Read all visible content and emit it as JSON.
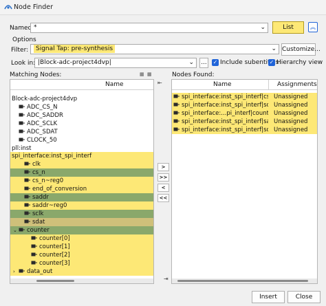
{
  "window": {
    "title": "Node Finder"
  },
  "named": {
    "label": "Named:",
    "value": "*"
  },
  "list_button": "List",
  "options": {
    "heading": "Options",
    "filter_label": "Filter:",
    "filter_value": "Signal Tap: pre-synthesis",
    "customize_label": "Customize...",
    "lookin_label": "Look in:",
    "lookin_value": "|Block-adc-project4dvp|",
    "browse_label": "...",
    "include_subentities": "Include subentities",
    "hierarchy_view": "Hierarchy view"
  },
  "matching": {
    "label": "Matching Nodes:",
    "header": "Name",
    "rows": [
      {
        "text": "Block-adc-project4dvp"
      },
      {
        "text": "ADC_CS_N"
      },
      {
        "text": "ADC_SADDR"
      },
      {
        "text": "ADC_SCLK"
      },
      {
        "text": "ADC_SDAT"
      },
      {
        "text": "CLOCK_50"
      },
      {
        "text": "pll:inst",
        "arrow": ">"
      },
      {
        "text": "spi_interface:inst_spi_interf",
        "arrow": "v"
      },
      {
        "text": "clk"
      },
      {
        "text": "cs_n"
      },
      {
        "text": "cs_n~reg0"
      },
      {
        "text": "end_of_conversion"
      },
      {
        "text": "saddr"
      },
      {
        "text": "saddr~reg0"
      },
      {
        "text": "sclk"
      },
      {
        "text": "sdat"
      },
      {
        "text": "counter",
        "arrow": "v"
      },
      {
        "text": "counter[0]"
      },
      {
        "text": "counter[1]"
      },
      {
        "text": "counter[2]"
      },
      {
        "text": "counter[3]"
      },
      {
        "text": "data_out",
        "arrow": ">"
      }
    ]
  },
  "transfer": {
    "add": ">",
    "add_all": ">>",
    "remove": "<",
    "remove_all": "<<"
  },
  "found": {
    "label": "Nodes Found:",
    "headers": [
      "Name",
      "Assignments"
    ],
    "rows": [
      {
        "name": "spi_interface:inst_spi_interf|cs_n",
        "assign": "Unassigned"
      },
      {
        "name": "spi_interface:inst_spi_interf|sclk",
        "assign": "Unassigned"
      },
      {
        "name": "spi_interface:...pi_interf|counter",
        "assign": "Unassigned"
      },
      {
        "name": "spi_interface:inst_spi_interf|saddr",
        "assign": "Unassigned"
      },
      {
        "name": "spi_interface:inst_spi_interf|sdat",
        "assign": "Unassigned"
      }
    ]
  },
  "footer": {
    "insert": "Insert",
    "close": "Close"
  },
  "colors": {
    "highlight": "#fde876",
    "selected_dark": "#8aa86b",
    "selected_mid": "#cfc07a",
    "accent": "#2064d8"
  }
}
